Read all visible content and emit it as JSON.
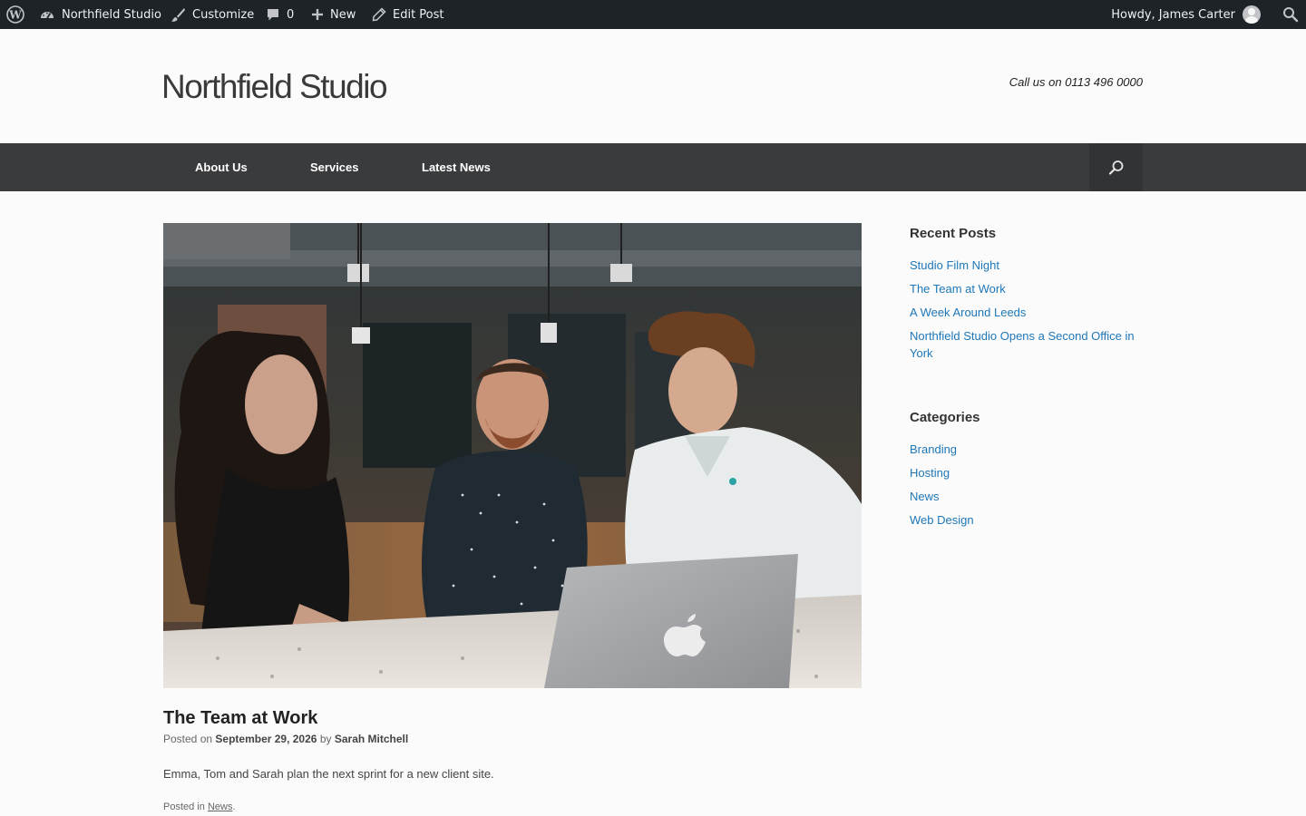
{
  "admin_bar": {
    "site_name": "Northfield Studio",
    "customize": "Customize",
    "comments_count": "0",
    "new": "New",
    "edit_post": "Edit Post",
    "howdy": "Howdy, James Carter"
  },
  "header": {
    "site_title": "Northfield Studio",
    "phone": "Call us on 0113 496 0000"
  },
  "nav": {
    "items": [
      {
        "label": "About Us"
      },
      {
        "label": "Services"
      },
      {
        "label": "Latest News"
      }
    ]
  },
  "post": {
    "title": "The Team at Work",
    "posted_on_label": "Posted on",
    "date": "September 29, 2026",
    "by_label": "by",
    "author": "Sarah Mitchell",
    "excerpt": "Emma, Tom and Sarah plan the next sprint for a new client site.",
    "posted_in_label": "Posted in",
    "category": "News"
  },
  "sidebar": {
    "recent_posts": {
      "title": "Recent Posts",
      "items": [
        "Studio Film Night",
        "The Team at Work",
        "A Week Around Leeds",
        "Northfield Studio Opens a Second Office in York"
      ]
    },
    "categories": {
      "title": "Categories",
      "items": [
        "Branding",
        "Hosting",
        "News",
        "Web Design"
      ]
    }
  },
  "colors": {
    "admin_bar": "#1d2327",
    "nav_bg": "#3a3b3d",
    "link": "#1e77b8"
  }
}
